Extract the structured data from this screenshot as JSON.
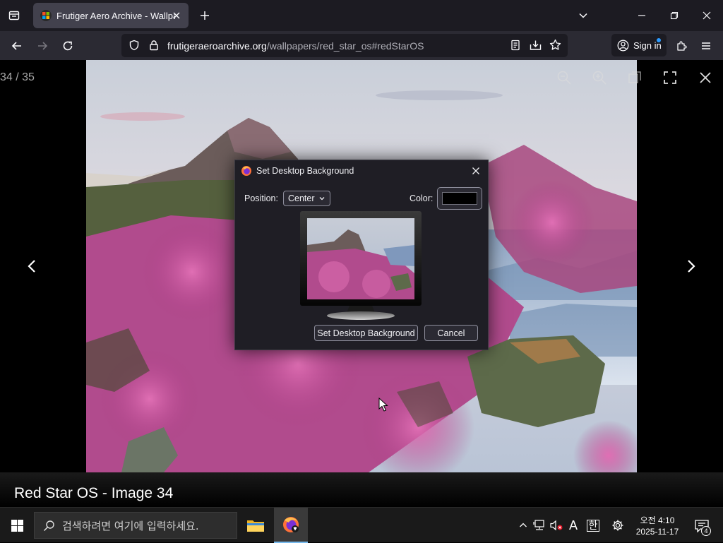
{
  "browser": {
    "tab_title": "Frutiger Aero Archive - Wallpapers",
    "url_domain": "frutigeraeroarchive.org",
    "url_path": "/wallpapers/red_star_os#redStarOS",
    "signin_label": "Sign in"
  },
  "viewer": {
    "counter": "34 / 35",
    "caption": "Red Star OS - Image 34"
  },
  "dialog": {
    "title": "Set Desktop Background",
    "position_label": "Position:",
    "position_value": "Center",
    "color_label": "Color:",
    "color_value": "#000000",
    "set_button": "Set Desktop Background",
    "cancel_button": "Cancel"
  },
  "taskbar": {
    "search_placeholder": "검색하려면 여기에 입력하세요.",
    "clock_time": "오전 4:10",
    "clock_date": "2025-11-17",
    "notification_count": "4",
    "ime_label": "A",
    "ime_hangul": "한"
  },
  "colors": {
    "accent": "#76b9ed",
    "tab_bg": "#42414d",
    "navbar_bg": "#2b2a33"
  }
}
